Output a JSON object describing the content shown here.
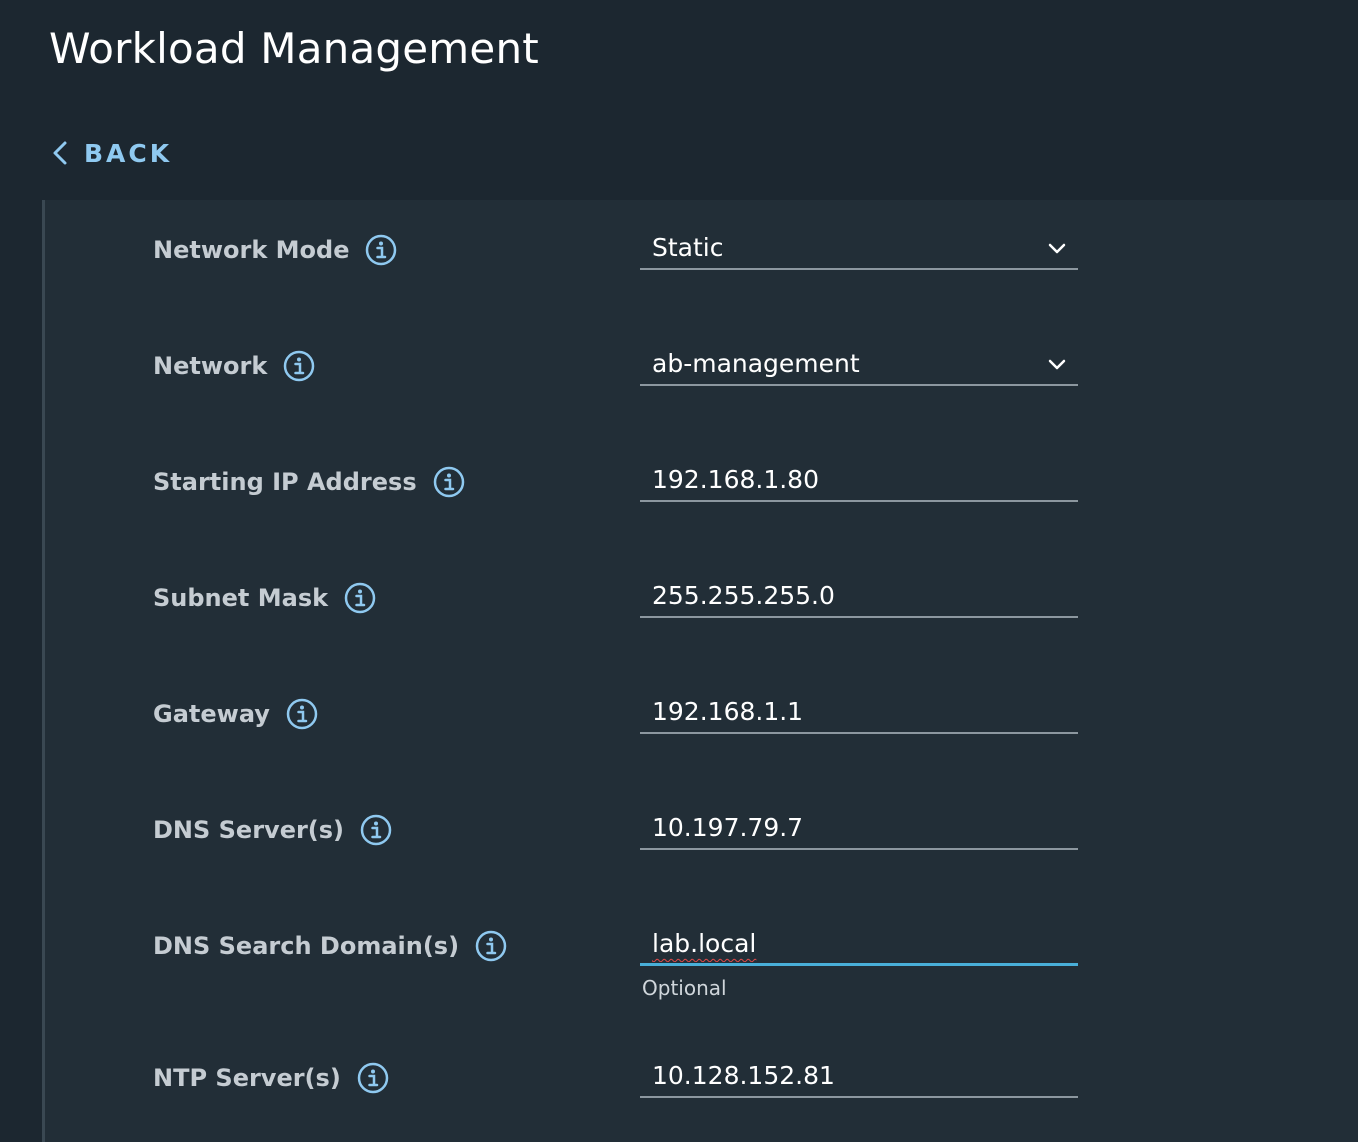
{
  "header": {
    "title": "Workload Management",
    "back_label": "BACK"
  },
  "form": {
    "network_mode": {
      "label": "Network Mode",
      "value": "Static"
    },
    "network": {
      "label": "Network",
      "value": "ab-management"
    },
    "starting_ip": {
      "label": "Starting IP Address",
      "value": "192.168.1.80"
    },
    "subnet_mask": {
      "label": "Subnet Mask",
      "value": "255.255.255.0"
    },
    "gateway": {
      "label": "Gateway",
      "value": "192.168.1.1"
    },
    "dns_servers": {
      "label": "DNS Server(s)",
      "value": "10.197.79.7"
    },
    "dns_search": {
      "label": "DNS Search Domain(s)",
      "value": "lab.local",
      "helper": "Optional"
    },
    "ntp_servers": {
      "label": "NTP Server(s)",
      "value": "10.128.152.81"
    }
  },
  "icons": {
    "info": "info-icon",
    "back": "chevron-left-icon",
    "dropdown": "chevron-down-icon"
  },
  "colors": {
    "background": "#1c2730",
    "panel": "#222e37",
    "accent": "#49afd9",
    "link": "#8fc9f0",
    "label": "#c5ccd2"
  }
}
